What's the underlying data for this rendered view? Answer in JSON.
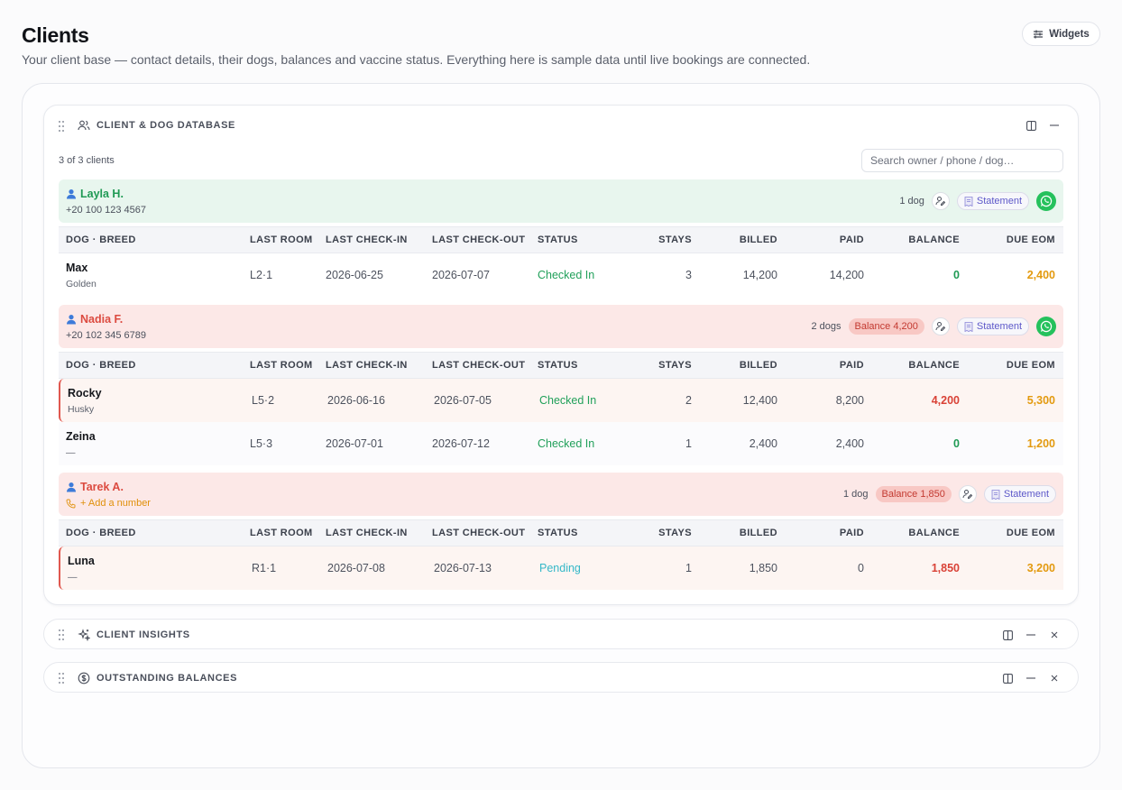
{
  "page": {
    "title": "Clients",
    "subtitle": "Your client base — contact details, their dogs, balances and vaccine status. Everything here is sample data until live bookings are connected.",
    "widgets_label": "Widgets"
  },
  "database": {
    "title": "CLIENT & DOG DATABASE",
    "count_text": "3 of 3 clients",
    "search_placeholder": "Search owner / phone / dog…",
    "columns": [
      "DOG · BREED",
      "LAST ROOM",
      "LAST CHECK-IN",
      "LAST CHECK-OUT",
      "STATUS",
      "STAYS",
      "BILLED",
      "PAID",
      "BALANCE",
      "DUE EOM"
    ],
    "statement_label": "Statement",
    "clients": [
      {
        "name": "Layla H.",
        "phone": "+20 100 123 4567",
        "dog_count": "1 dog",
        "balance_badge": "",
        "dogs": [
          {
            "name": "Max",
            "breed": "Golden",
            "room": "L2·1",
            "check_in": "2026-06-25",
            "check_out": "2026-07-07",
            "status": "Checked In",
            "stays": "3",
            "billed": "14,200",
            "paid": "14,200",
            "balance": "0",
            "due": "2,400"
          }
        ]
      },
      {
        "name": "Nadia F.",
        "phone": "+20 102 345 6789",
        "dog_count": "2 dogs",
        "balance_badge": "Balance 4,200",
        "dogs": [
          {
            "name": "Rocky",
            "breed": "Husky",
            "room": "L5·2",
            "check_in": "2026-06-16",
            "check_out": "2026-07-05",
            "status": "Checked In",
            "stays": "2",
            "billed": "12,400",
            "paid": "8,200",
            "balance": "4,200",
            "due": "5,300"
          },
          {
            "name": "Zeina",
            "breed": "—",
            "room": "L5·3",
            "check_in": "2026-07-01",
            "check_out": "2026-07-12",
            "status": "Checked In",
            "stays": "1",
            "billed": "2,400",
            "paid": "2,400",
            "balance": "0",
            "due": "1,200"
          }
        ]
      },
      {
        "name": "Tarek A.",
        "add_number": "+ Add a number",
        "dog_count": "1 dog",
        "balance_badge": "Balance 1,850",
        "dogs": [
          {
            "name": "Luna",
            "breed": "—",
            "room": "R1·1",
            "check_in": "2026-07-08",
            "check_out": "2026-07-13",
            "status": "Pending",
            "stays": "1",
            "billed": "1,850",
            "paid": "0",
            "balance": "1,850",
            "due": "3,200"
          }
        ]
      }
    ]
  },
  "insights": {
    "title": "CLIENT INSIGHTS"
  },
  "outstanding": {
    "title": "OUTSTANDING BALANCES"
  },
  "colors": {
    "accent_green": "#1f9a54",
    "accent_red": "#dc4b40",
    "due_orange": "#e39a0f",
    "statement_purple": "#5d58c9",
    "whatsapp": "#25c15c"
  },
  "icons": [
    "drag-handle-icon",
    "users-icon",
    "sparkle-icon",
    "dollar-circle-icon",
    "columns-icon",
    "minimize-icon",
    "close-icon",
    "user-icon",
    "reassign-icon",
    "receipt-icon",
    "whatsapp-icon",
    "phone-icon",
    "sliders-icon"
  ]
}
